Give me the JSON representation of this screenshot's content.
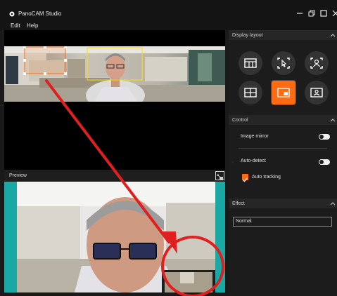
{
  "app": {
    "title": "PanoCAM Studio"
  },
  "menu": {
    "items": [
      "Edit",
      "Help"
    ]
  },
  "preview": {
    "label": "Preview"
  },
  "sidebar": {
    "display_layout": {
      "title": "Display layout",
      "selected_index": 4,
      "options": [
        "grid-layout-icon",
        "pointer-focus-icon",
        "person-frame-icon",
        "quad-layout-icon",
        "picture-in-picture-icon",
        "presenter-icon"
      ]
    },
    "control": {
      "title": "Control",
      "image_mirror": {
        "label": "Image mirror",
        "on": false
      },
      "auto_detect": {
        "label": "Auto-detect",
        "on": false
      },
      "auto_tracking": {
        "label": "Auto tracking",
        "checked": true
      }
    },
    "effect": {
      "title": "Effect",
      "value": "Normal"
    }
  },
  "colors": {
    "accent": "#ff6a13",
    "annotation": "#e02020",
    "teal": "#1aa8a4",
    "panel": "#1c1c1c"
  }
}
